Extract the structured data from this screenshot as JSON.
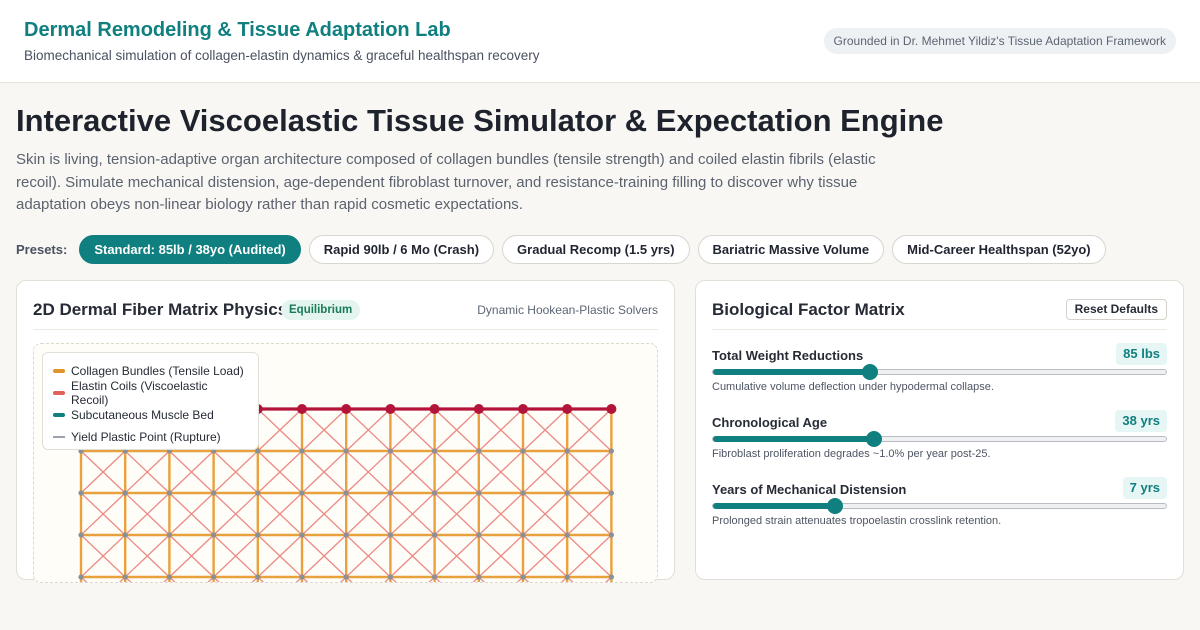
{
  "header": {
    "title": "Dermal Remodeling & Tissue Adaptation Lab",
    "subtitle": "Biomechanical simulation of collagen-elastin dynamics & graceful healthspan recovery",
    "badge": "Grounded in Dr. Mehmet Yildiz's Tissue Adaptation Framework"
  },
  "main": {
    "title": "Interactive Viscoelastic Tissue Simulator & Expectation Engine",
    "description": "Skin is living, tension-adaptive organ architecture composed of collagen bundles (tensile strength) and coiled elastin fibrils (elastic recoil). Simulate mechanical distension, age-dependent fibroblast turnover, and resistance-training filling to discover why tissue adaptation obeys non-linear biology rather than rapid cosmetic expectations."
  },
  "presets": {
    "label": "Presets:",
    "items": [
      {
        "label": "Standard: 85lb / 38yo (Audited)",
        "active": true
      },
      {
        "label": "Rapid 90lb / 6 Mo (Crash)",
        "active": false
      },
      {
        "label": "Gradual Recomp (1.5 yrs)",
        "active": false
      },
      {
        "label": "Bariatric Massive Volume",
        "active": false
      },
      {
        "label": "Mid-Career Healthspan (52yo)",
        "active": false
      }
    ]
  },
  "physics_panel": {
    "title": "2D Dermal Fiber Matrix Physics",
    "status": "Equilibrium",
    "note": "Dynamic Hookean-Plastic Solvers",
    "legend": [
      {
        "label": "Collagen Bundles (Tensile Load)",
        "color": "#e0952a",
        "style": "solid"
      },
      {
        "label": "Elastin Coils (Viscoelastic Recoil)",
        "color": "#e0615a",
        "style": "solid"
      },
      {
        "label": "Subcutaneous Muscle Bed",
        "color": "#0f7f7f",
        "style": "solid"
      },
      {
        "label": "Yield Plastic Point (Rupture)",
        "color": "#9aa3ad",
        "style": "dashed"
      }
    ],
    "colors": {
      "collagen": "#e8a13c",
      "elastin": "#ec8a85",
      "surface": "#b3143a",
      "node": "#8a9099"
    }
  },
  "factors_panel": {
    "title": "Biological Factor Matrix",
    "reset_label": "Reset Defaults",
    "factors": [
      {
        "label": "Total Weight Reductions",
        "value": "85 lbs",
        "fraction": 0.347,
        "hint": "Cumulative volume deflection under hypodermal collapse."
      },
      {
        "label": "Chronological Age",
        "value": "38 yrs",
        "fraction": 0.355,
        "hint": "Fibroblast proliferation degrades ~1.0% per year post-25."
      },
      {
        "label": "Years of Mechanical Distension",
        "value": "7 yrs",
        "fraction": 0.27,
        "hint": "Prolonged strain attenuates tropoelastin crosslink retention."
      }
    ]
  },
  "accent": "#0f7f7f"
}
